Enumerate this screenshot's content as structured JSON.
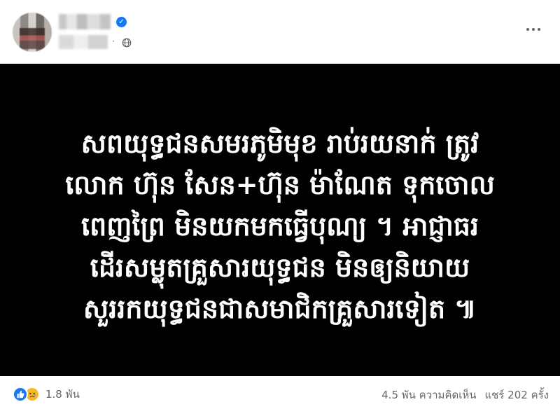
{
  "post": {
    "text_lines": [
      "សពយុទ្ធជនសមរភូមិមុខ រាប់រយនាក់ ត្រូវ",
      "លោក ហ៊ុន សែន+ហ៊ុន ម៉ាណែត ទុកចោល",
      "ពេញព្រៃ មិនយកមកធ្វើបុណ្យ ។ អាជ្ញាធរ",
      "ដើរសម្លុតគ្រួសារយុទ្ធជន មិនឲ្យនិយាយ",
      "សួររកយុទ្ធជនជាសមាជិកគ្រួសារទៀត ៕"
    ]
  },
  "header": {
    "separator": "·"
  },
  "footer": {
    "reaction_count": "1.8 พัน",
    "comments": "4.5 พัน ความคิดเห็น",
    "shares": "แชร์ 202 ครั้ง"
  },
  "icons": {
    "verified": "verified-badge-icon",
    "globe": "globe-icon",
    "more": "more-options-icon",
    "like": "like-reaction-icon",
    "sad": "sad-reaction-icon"
  },
  "colors": {
    "facebook_blue": "#1877f2",
    "muted_text": "#65676b",
    "image_background": "#000000",
    "sad_yellow": "#f7b928"
  }
}
